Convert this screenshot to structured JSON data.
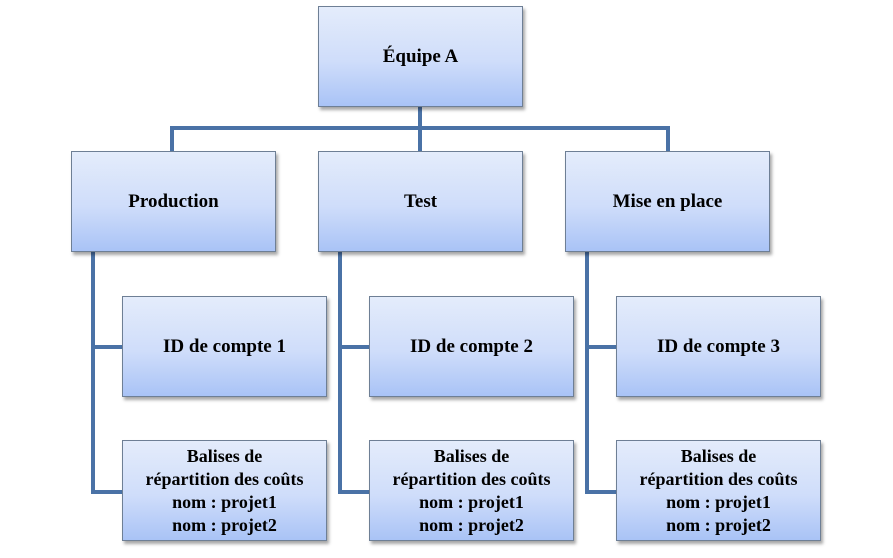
{
  "diagram": {
    "type": "org-chart",
    "root": {
      "label": "Équipe A"
    },
    "branches": [
      {
        "label": "Production",
        "account": "ID de compte 1",
        "tags": [
          "Balises de",
          "répartition des coûts",
          "nom : projet1",
          "nom : projet2"
        ]
      },
      {
        "label": "Test",
        "account": "ID de compte 2",
        "tags": [
          "Balises de",
          "répartition des coûts",
          "nom : projet1",
          "nom : projet2"
        ]
      },
      {
        "label": "Mise en place",
        "account": "ID de compte 3",
        "tags": [
          "Balises de",
          "répartition des coûts",
          "nom : projet1",
          "nom : projet2"
        ]
      }
    ],
    "colors": {
      "connector": "#4a72a6",
      "box_top": "#e4ecfb",
      "box_bottom": "#a9c3f6",
      "box_border": "#6e7f95"
    }
  }
}
